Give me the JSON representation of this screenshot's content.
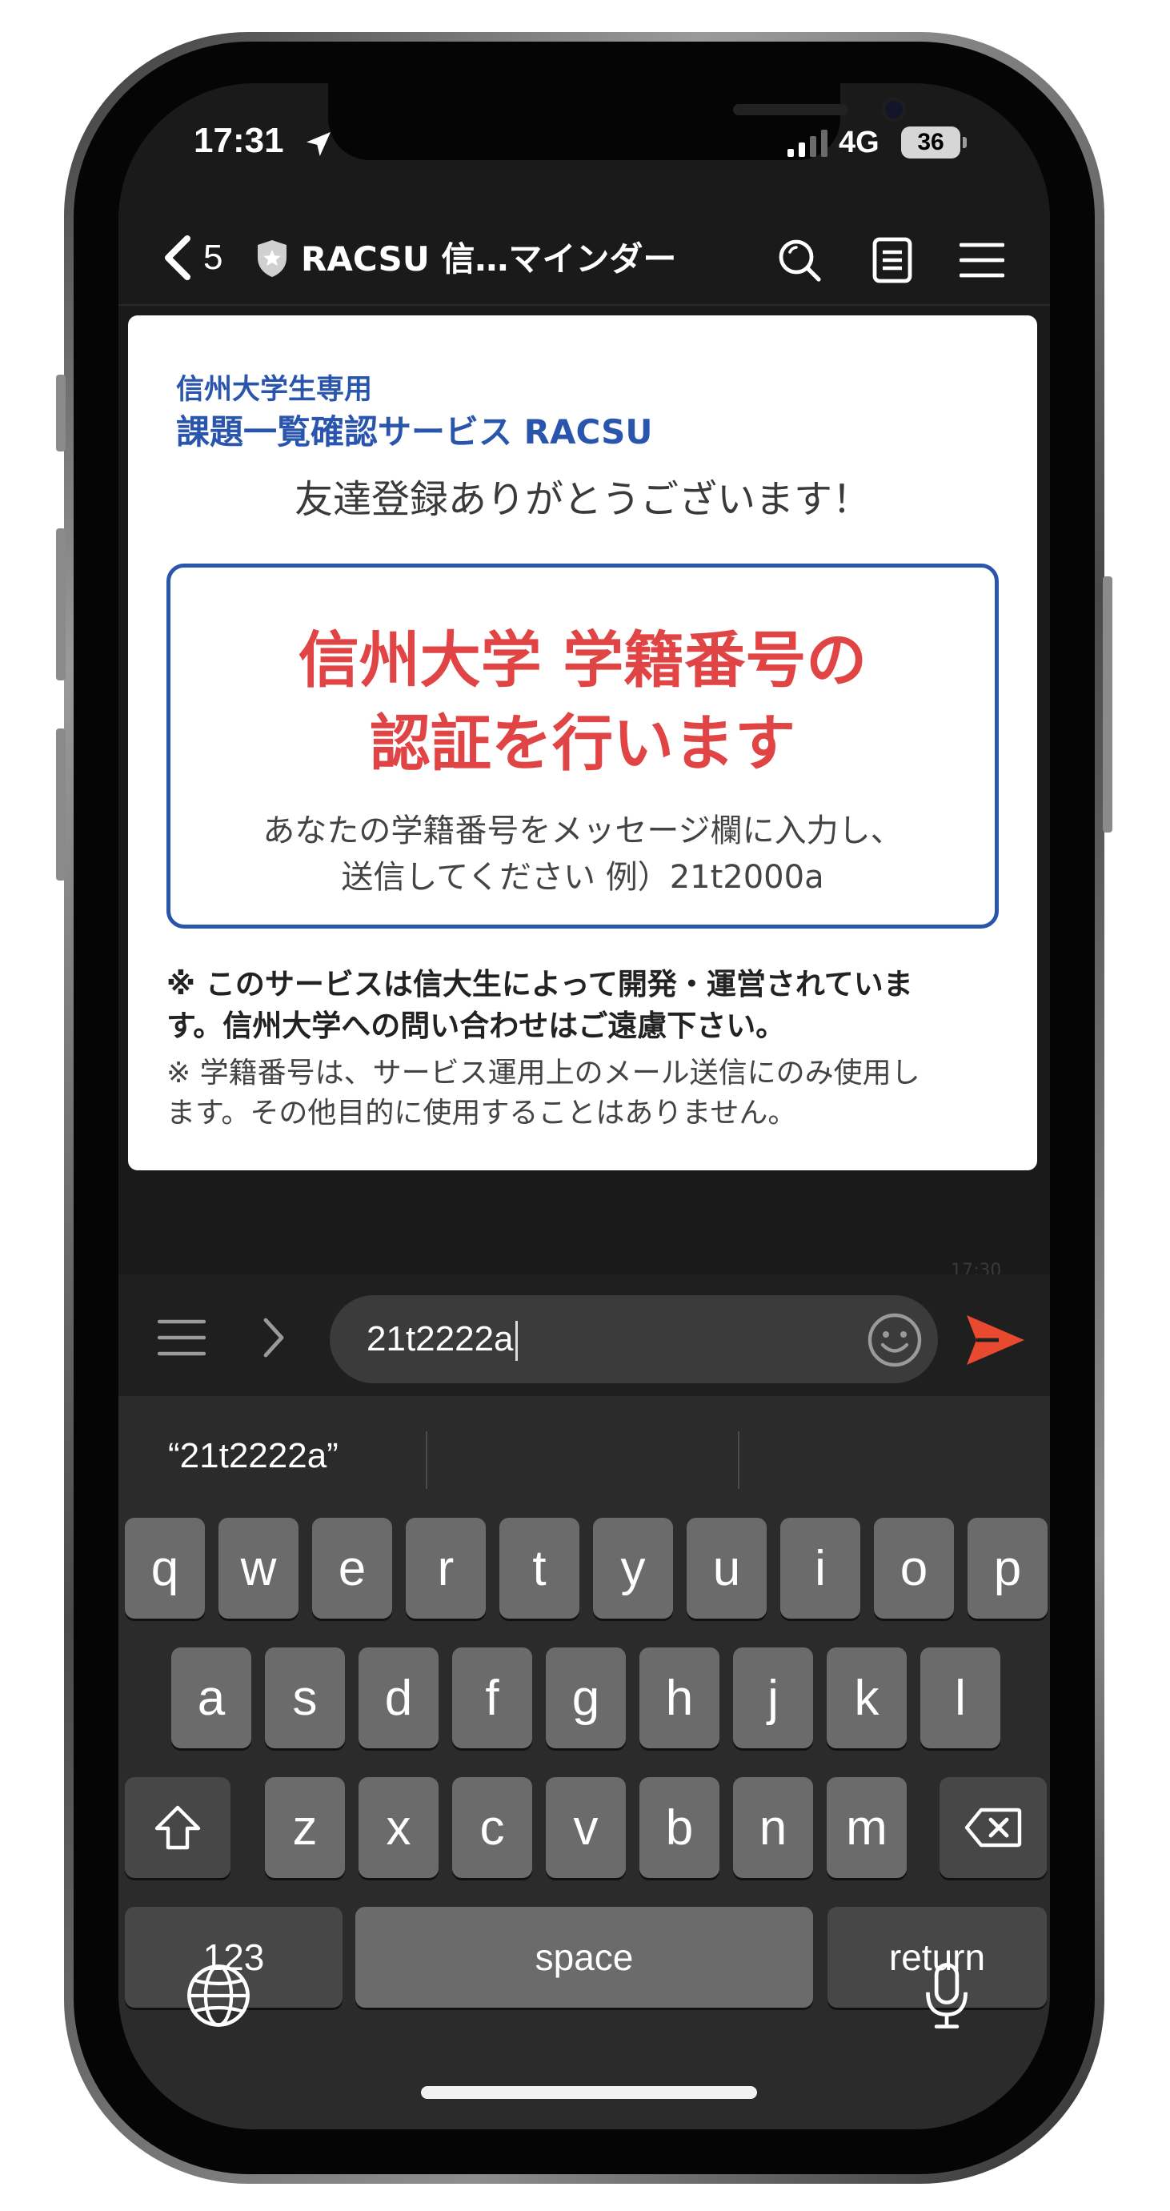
{
  "status_bar": {
    "time": "17:31",
    "network": "4G",
    "battery_level": "36"
  },
  "header": {
    "back_count": "5",
    "title": "RACSU 信…マインダー",
    "icons": [
      "back-chevron-icon",
      "verified-shield-icon",
      "search-icon",
      "note-icon",
      "menu-icon"
    ]
  },
  "card": {
    "brand_line_1": "信州大学生専用",
    "brand_line_2": "課題一覧確認サービス RACSU",
    "greeting": "友達登録ありがとうございます！",
    "auth_title_line_1": "信州大学 学籍番号の",
    "auth_title_line_2": "認証を行います",
    "auth_desc_line_1": "あなたの学籍番号をメッセージ欄に入力し、",
    "auth_desc_line_2": "送信してください 例）21t2000a",
    "notice_bold_line_1": "※ このサービスは信大生によって開発・運営されていま",
    "notice_bold_line_2": "す。信州大学への問い合わせはご遠慮下さい。",
    "notice_line_1": "※ 学籍番号は、サービス運用上のメール送信にのみ使用し",
    "notice_line_2": "ます。その他目的に使用することはありません。"
  },
  "timestamp_faint": "17:30",
  "input": {
    "value": "21t2222a"
  },
  "keyboard": {
    "suggestion": "“21t2222a”",
    "row1": [
      "q",
      "w",
      "e",
      "r",
      "t",
      "y",
      "u",
      "i",
      "o",
      "p"
    ],
    "row2": [
      "a",
      "s",
      "d",
      "f",
      "g",
      "h",
      "j",
      "k",
      "l"
    ],
    "row3": [
      "z",
      "x",
      "c",
      "v",
      "b",
      "n",
      "m"
    ],
    "numbers_label": "123",
    "space_label": "space",
    "return_label": "return",
    "shift_icon": "shift-icon",
    "delete_icon": "delete-icon",
    "globe_icon": "globe-icon",
    "mic_icon": "microphone-icon"
  },
  "colors": {
    "brand_blue": "#2a55ad",
    "auth_red": "#e04444",
    "send_orange": "#e8492f",
    "key_gray": "#6b6b6b",
    "keyboard_bg": "#2b2b2b"
  }
}
